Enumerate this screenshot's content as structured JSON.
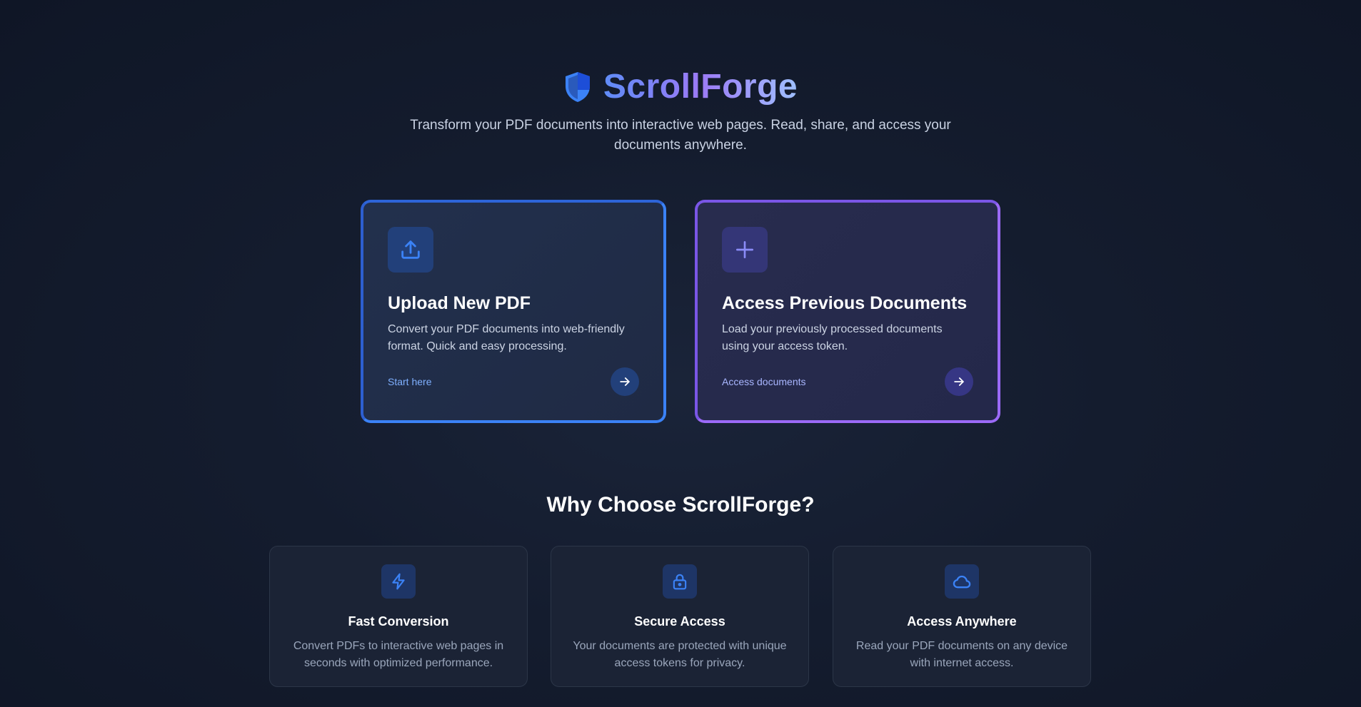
{
  "brand": {
    "name": "ScrollForge",
    "tagline": "Transform your PDF documents into interactive web pages. Read, share, and access your documents anywhere."
  },
  "cards": {
    "upload": {
      "icon": "upload-icon",
      "title": "Upload New PDF",
      "description": "Convert your PDF documents into web-friendly format. Quick and easy processing.",
      "link_label": "Start here"
    },
    "access": {
      "icon": "plus-icon",
      "title": "Access Previous Documents",
      "description": "Load your previously processed documents using your access token.",
      "link_label": "Access documents"
    }
  },
  "why": {
    "title": "Why Choose ScrollForge?",
    "features": [
      {
        "icon": "lightning-icon",
        "title": "Fast Conversion",
        "description": "Convert PDFs to interactive web pages in seconds with optimized performance."
      },
      {
        "icon": "lock-icon",
        "title": "Secure Access",
        "description": "Your documents are protected with unique access tokens for privacy."
      },
      {
        "icon": "cloud-icon",
        "title": "Access Anywhere",
        "description": "Read your PDF documents on any device with internet access."
      }
    ]
  },
  "colors": {
    "background": "#141c2e",
    "upload_accent": "#3b82f6",
    "access_accent": "#8b5cf6",
    "icon_blue": "#3b82f6",
    "icon_purple": "#8b8cf8"
  }
}
